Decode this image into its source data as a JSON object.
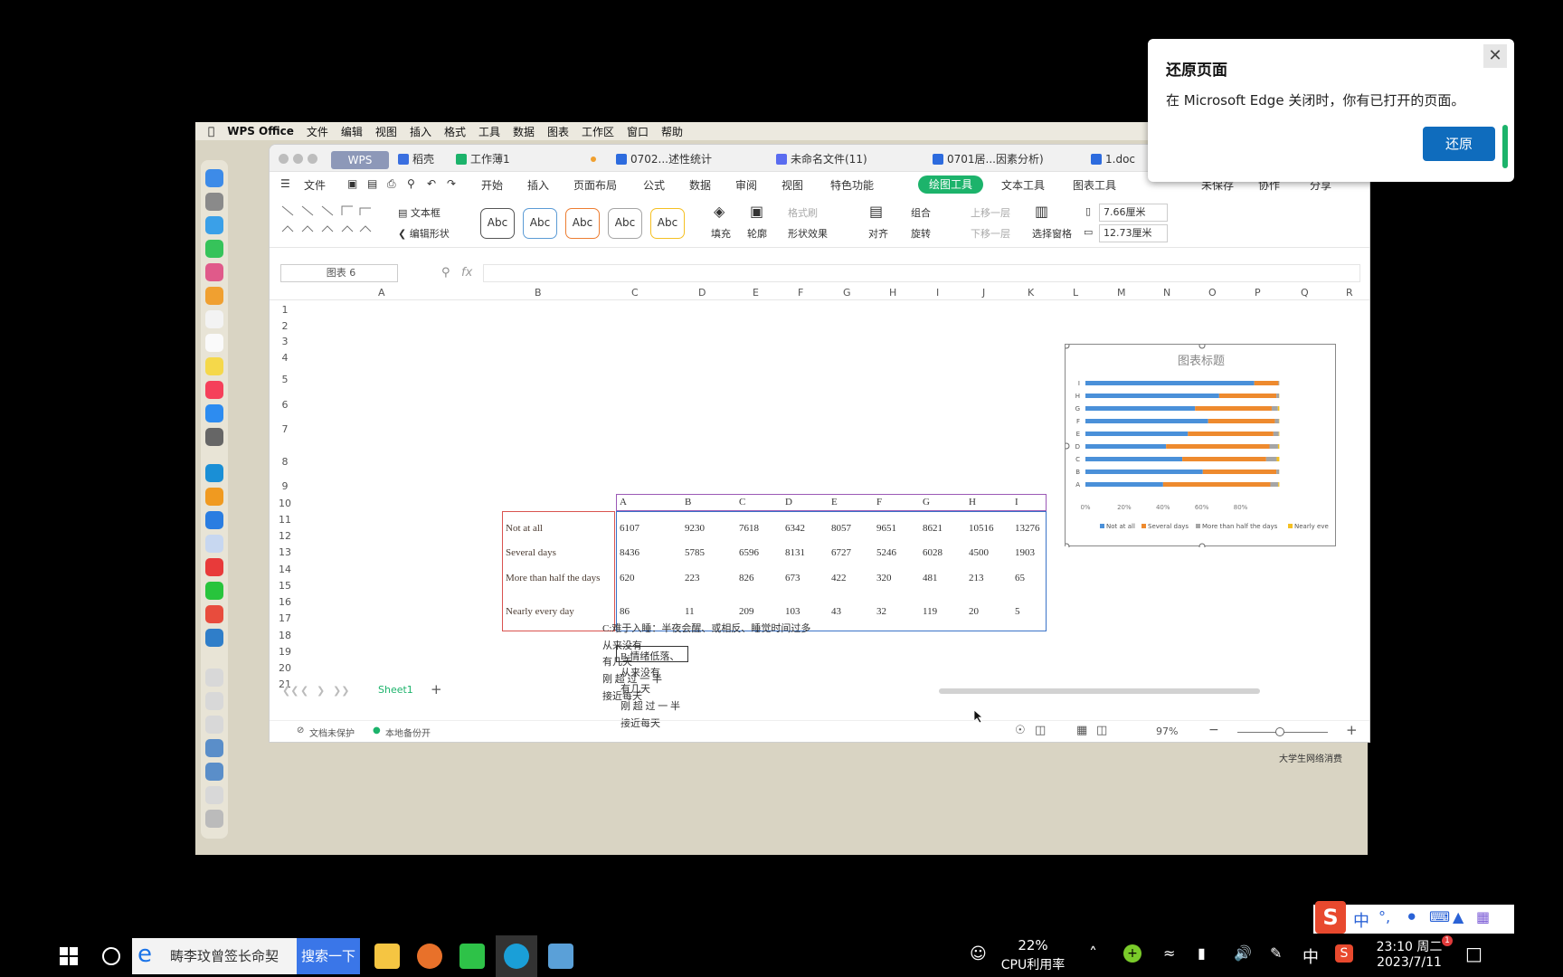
{
  "mac_menubar": {
    "brand": "WPS Office",
    "items": [
      "文件",
      "编辑",
      "视图",
      "插入",
      "格式",
      "工具",
      "数据",
      "图表",
      "工作区",
      "窗口",
      "帮助"
    ]
  },
  "window_tabs": {
    "wps": "WPS",
    "tabs": [
      "稻壳",
      "工作薄1",
      "0702...述性统计",
      "未命名文件(11)",
      "0701居...因素分析)",
      "1.doc"
    ]
  },
  "menu_row": {
    "file": "文件",
    "items": [
      "开始",
      "插入",
      "页面布局",
      "公式",
      "数据",
      "审阅",
      "视图",
      "特色功能"
    ],
    "active": "绘图工具",
    "after": [
      "文本工具",
      "图表工具"
    ],
    "right": [
      "未保存",
      "协作",
      "分享"
    ]
  },
  "ribbon": {
    "textbox": "文本框",
    "edit_shape": "编辑形状",
    "abc": "Abc",
    "fill": "填充",
    "outline": "轮廓",
    "format_brush": "格式刷",
    "shape_effect": "形状效果",
    "align": "对齐",
    "group": "组合",
    "rotate": "旋转",
    "up_layer": "上移一层",
    "down_layer": "下移一层",
    "select_pane": "选择窗格",
    "height": "7.66厘米",
    "width": "12.73厘米"
  },
  "formula": {
    "name_box": "图表 6",
    "fx": "fx"
  },
  "columns": [
    "A",
    "B",
    "C",
    "D",
    "E",
    "F",
    "G",
    "H",
    "I",
    "J",
    "K",
    "L",
    "M",
    "N",
    "O",
    "P",
    "Q",
    "R"
  ],
  "rows": [
    "1",
    "2",
    "3",
    "4",
    "5",
    "6",
    "7",
    "8",
    "9",
    "10",
    "11",
    "12",
    "13",
    "14",
    "15",
    "16",
    "17",
    "18",
    "19",
    "20",
    "21"
  ],
  "table": {
    "headers": [
      "A",
      "B",
      "C",
      "D",
      "E",
      "F",
      "G",
      "H",
      "I"
    ],
    "rows": [
      {
        "label": "Not at all",
        "values": [
          "6107",
          "9230",
          "7618",
          "6342",
          "8057",
          "9651",
          "8621",
          "10516",
          "13276"
        ]
      },
      {
        "label": "Several days",
        "values": [
          "8436",
          "5785",
          "6596",
          "8131",
          "6727",
          "5246",
          "6028",
          "4500",
          "1903"
        ]
      },
      {
        "label": "More than half the days",
        "values": [
          "620",
          "223",
          "826",
          "673",
          "422",
          "320",
          "481",
          "213",
          "65"
        ]
      },
      {
        "label": "Nearly every day",
        "values": [
          "86",
          "11",
          "209",
          "103",
          "43",
          "32",
          "119",
          "20",
          "5"
        ]
      }
    ]
  },
  "notes": {
    "b_title": "B:情绪低落、",
    "b_items": [
      "从来没有",
      "有几天",
      "刚 超 过 一 半",
      "接近每天"
    ],
    "c_title": "C:难于入睡：半夜会醒、或相反、睡觉时间过多",
    "c_items": [
      "从来没有",
      "有几天",
      "刚 超 过 一 半",
      "接近每天"
    ]
  },
  "sheet_tab": "Sheet1",
  "status": {
    "protect": "文档未保护",
    "backup": "本地备份开",
    "zoom": "97%"
  },
  "desktop_label": "大学生网络消费",
  "chart_data": {
    "type": "bar",
    "orientation": "horizontal",
    "stacked": "percent",
    "title": "图表标题",
    "categories": [
      "A",
      "B",
      "C",
      "D",
      "E",
      "F",
      "G",
      "H",
      "I"
    ],
    "series": [
      {
        "name": "Not at all",
        "color": "#4a90d9",
        "values": [
          6107,
          9230,
          7618,
          6342,
          8057,
          9651,
          8621,
          10516,
          13276
        ]
      },
      {
        "name": "Several days",
        "color": "#ee8a2e",
        "values": [
          8436,
          5785,
          6596,
          8131,
          6727,
          5246,
          6028,
          4500,
          1903
        ]
      },
      {
        "name": "More than half the days",
        "color": "#a5a5a5",
        "values": [
          620,
          223,
          826,
          673,
          422,
          320,
          481,
          213,
          65
        ]
      },
      {
        "name": "Nearly every day",
        "color": "#f5c022",
        "values": [
          86,
          11,
          209,
          103,
          43,
          32,
          119,
          20,
          5
        ]
      }
    ],
    "xticks": [
      "0%",
      "20%",
      "40%",
      "60%",
      "80%"
    ],
    "legend_labels": [
      "Not at all",
      "Several days",
      "More than half the days",
      "Nearly eve"
    ],
    "legend": "bottom"
  },
  "popup": {
    "title": "还原页面",
    "message": "在 Microsoft Edge 关闭时，你有已打开的页面。",
    "button": "还原",
    "close": "✕"
  },
  "taskbar": {
    "search_text": "畴李玟曾签长命契",
    "search_button": "搜索一下",
    "cpu_value": "22%",
    "cpu_label": "CPU利用率",
    "ime": "中",
    "time": "23:10 周二",
    "date": "2023/7/11",
    "notify_count": "1"
  },
  "ime_bar": {
    "zh": "中",
    "punct": "°,"
  }
}
